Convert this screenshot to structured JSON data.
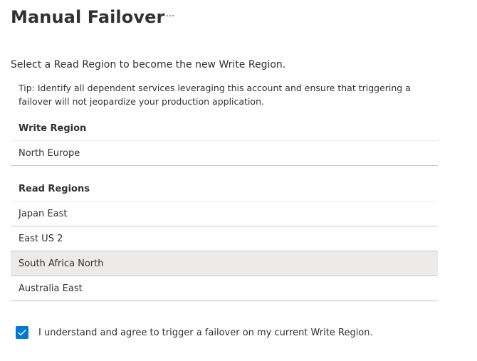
{
  "page": {
    "title": "Manual Failover",
    "more_label": "···"
  },
  "subtitle": "Select a Read Region to become the new Write Region.",
  "tip": "Tip: Identify all dependent services leveraging this account and ensure that triggering a failover will not jeopardize your production application.",
  "write_region": {
    "header": "Write Region",
    "value": "North Europe"
  },
  "read_regions": {
    "header": "Read Regions",
    "items": [
      {
        "label": "Japan East"
      },
      {
        "label": "East US 2"
      },
      {
        "label": "South Africa North",
        "selected": true
      },
      {
        "label": "Australia East"
      }
    ]
  },
  "consent": {
    "label": "I understand and agree to trigger a failover on my current Write Region.",
    "checked": true
  },
  "colors": {
    "accent": "#0078d4",
    "selected_row": "#edebe9",
    "text": "#323130"
  }
}
